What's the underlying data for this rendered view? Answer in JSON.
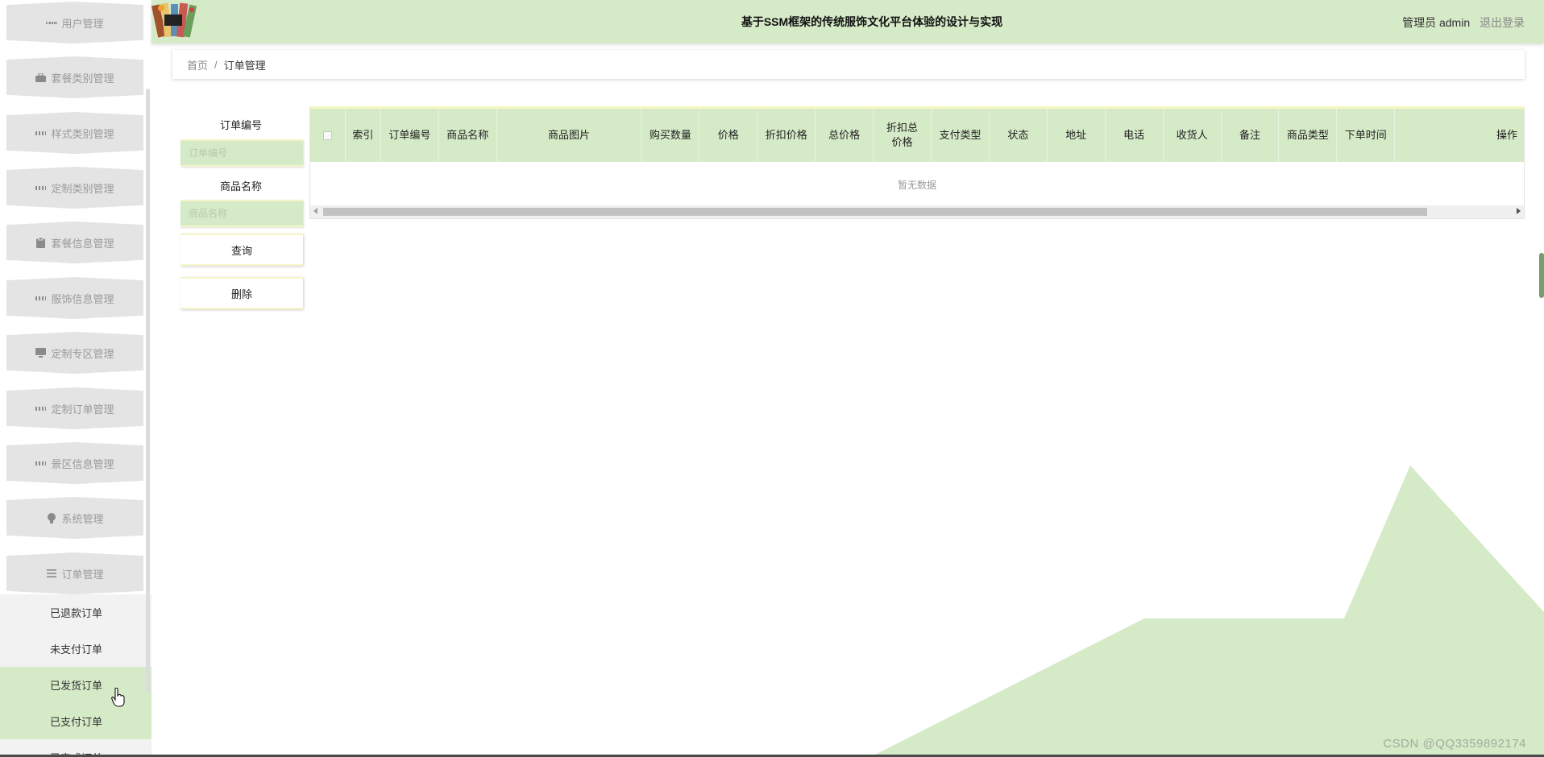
{
  "header": {
    "title": "基于SSM框架的传统服饰文化平台体验的设计与实现",
    "user_role": "管理员",
    "username": "admin",
    "logout": "退出登录"
  },
  "sidebar": {
    "items": [
      {
        "label": "用户管理",
        "icon": "grid-icon"
      },
      {
        "label": "套餐类别管理",
        "icon": "briefcase-icon"
      },
      {
        "label": "样式类别管理",
        "icon": "grid-icon"
      },
      {
        "label": "定制类别管理",
        "icon": "grid-icon"
      },
      {
        "label": "套餐信息管理",
        "icon": "clipboard-icon"
      },
      {
        "label": "服饰信息管理",
        "icon": "grid-icon"
      },
      {
        "label": "定制专区管理",
        "icon": "monitor-icon"
      },
      {
        "label": "定制订单管理",
        "icon": "grid-icon"
      },
      {
        "label": "景区信息管理",
        "icon": "grid-icon"
      },
      {
        "label": "系统管理",
        "icon": "bulb-icon"
      },
      {
        "label": "订单管理",
        "icon": "list-icon"
      }
    ],
    "submenu": [
      {
        "label": "已退款订单"
      },
      {
        "label": "未支付订单"
      },
      {
        "label": "已发货订单"
      },
      {
        "label": "已支付订单"
      },
      {
        "label": "已完成订单"
      }
    ]
  },
  "breadcrumb": {
    "home": "首页",
    "separator": "/",
    "current": "订单管理"
  },
  "search": {
    "order_no_label": "订单编号",
    "order_no_placeholder": "订单编号",
    "product_name_label": "商品名称",
    "product_name_placeholder": "商品名称",
    "query_button": "查询",
    "delete_button": "删除"
  },
  "table": {
    "columns": [
      "索引",
      "订单编号",
      "商品名称",
      "商品图片",
      "购买数量",
      "价格",
      "折扣价格",
      "总价格",
      "折扣总价格",
      "支付类型",
      "状态",
      "地址",
      "电话",
      "收货人",
      "备注",
      "商品类型",
      "下单时间",
      "操作"
    ],
    "empty_text": "暂无数据"
  },
  "watermark": "CSDN @QQ3359892174",
  "colors": {
    "accent": "#d5eac7",
    "header_bg": "#d5eac7",
    "menu_bg": "#e4e4e4",
    "border_highlight": "#f5f5c8"
  }
}
